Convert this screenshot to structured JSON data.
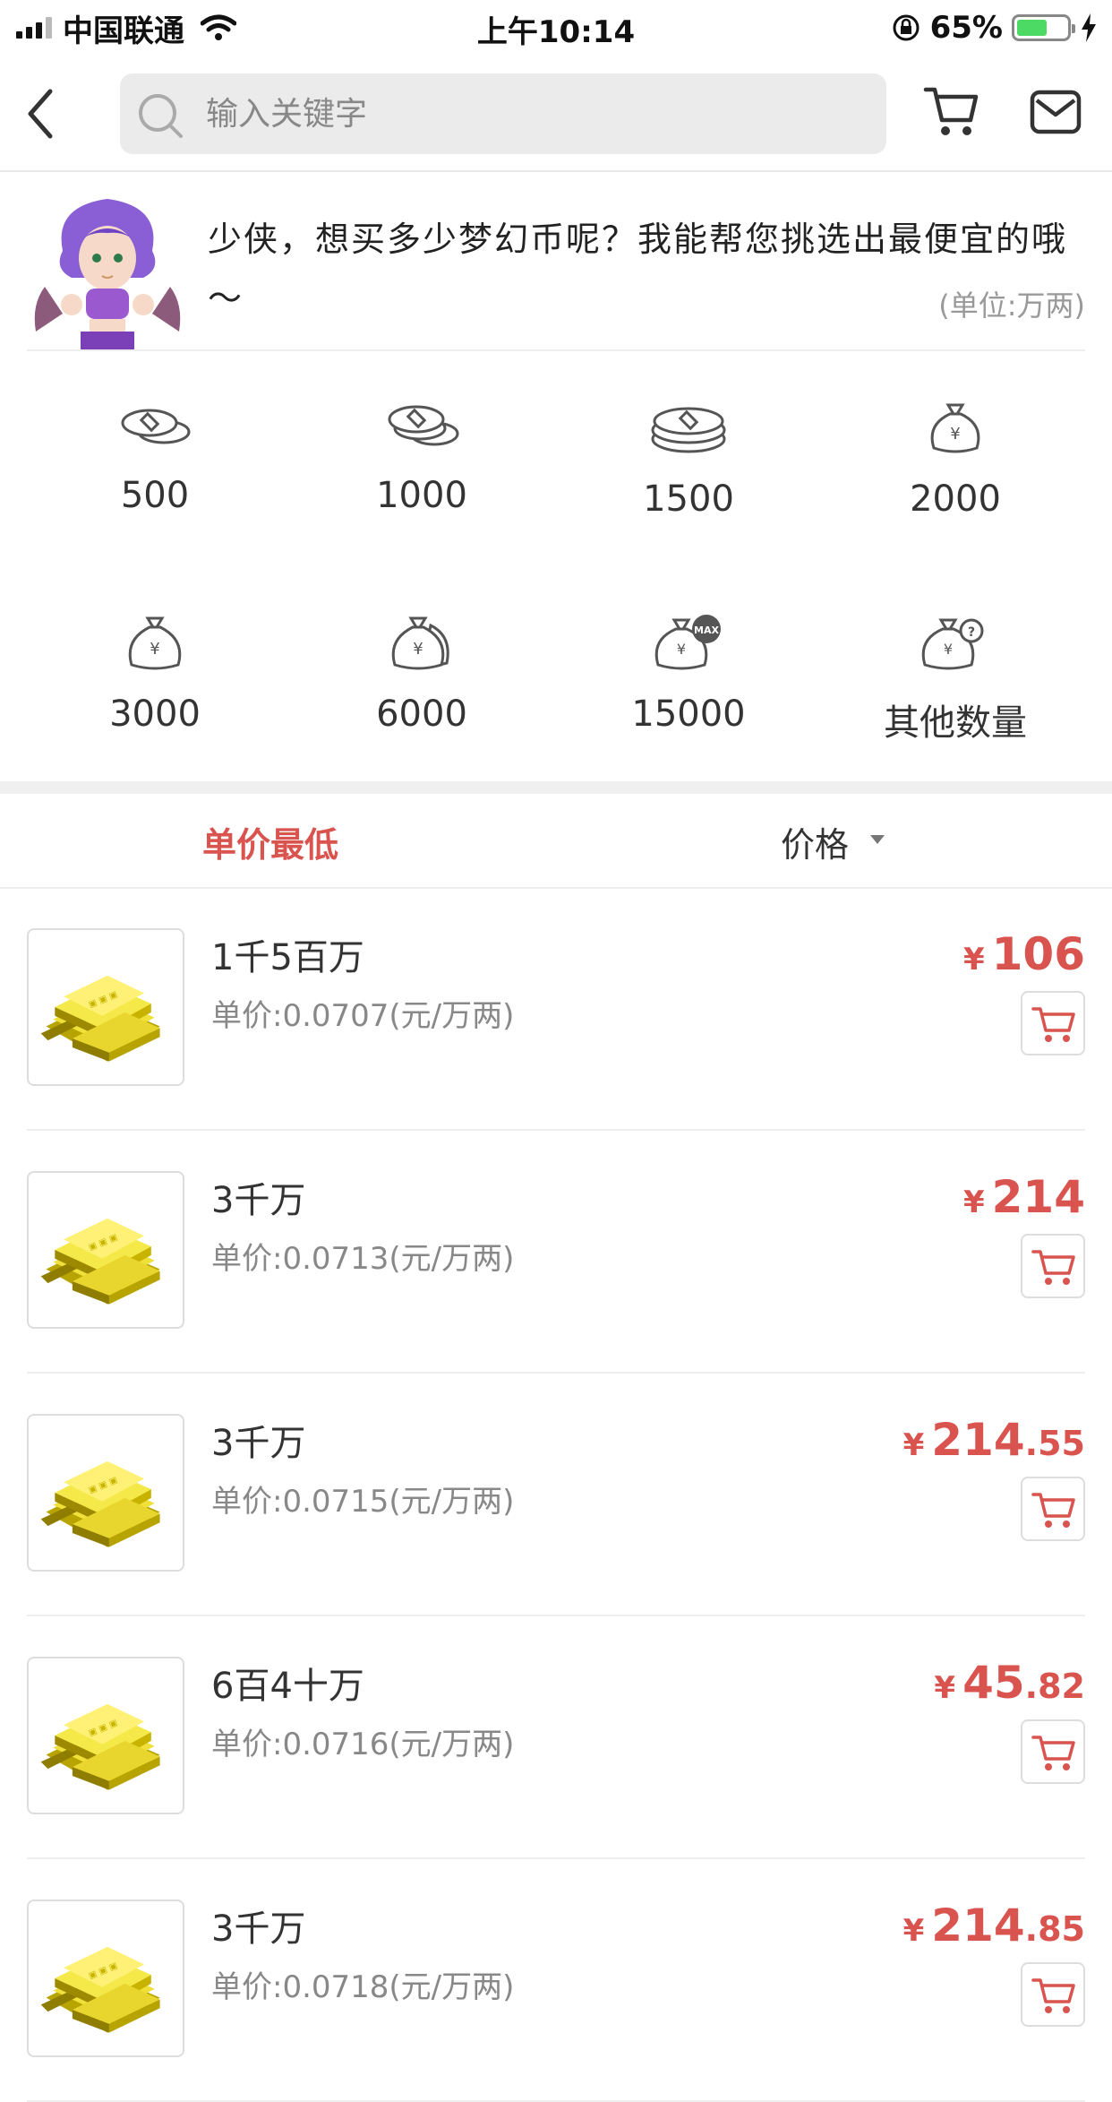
{
  "status_bar": {
    "carrier": "中国联通",
    "time": "上午10:14",
    "battery_percent": "65%",
    "battery_level": 0.65
  },
  "nav": {
    "search_placeholder": "输入关键字"
  },
  "banner": {
    "message": "少侠，想买多少梦幻币呢？我能帮您挑选出最便宜的哦～",
    "unit_note": "(单位:万两)"
  },
  "amounts": [
    {
      "label": "500",
      "icon": "coins-icon"
    },
    {
      "label": "1000",
      "icon": "coins-icon"
    },
    {
      "label": "1500",
      "icon": "coin-stack-icon"
    },
    {
      "label": "2000",
      "icon": "money-bag-icon"
    },
    {
      "label": "3000",
      "icon": "money-bag-icon"
    },
    {
      "label": "6000",
      "icon": "money-bags-icon"
    },
    {
      "label": "15000",
      "icon": "money-bag-max-icon"
    },
    {
      "label": "其他数量",
      "icon": "money-bag-question-icon"
    }
  ],
  "sort": {
    "lowest_label": "单价最低",
    "price_label": "价格"
  },
  "listings": [
    {
      "quantity": "1千5百万",
      "unit_price": "单价:0.0707(元/万两)",
      "currency": "¥",
      "price_int": "106",
      "price_dec": ""
    },
    {
      "quantity": "3千万",
      "unit_price": "单价:0.0713(元/万两)",
      "currency": "¥",
      "price_int": "214",
      "price_dec": ""
    },
    {
      "quantity": "3千万",
      "unit_price": "单价:0.0715(元/万两)",
      "currency": "¥",
      "price_int": "214",
      "price_dec": ".55"
    },
    {
      "quantity": "6百4十万",
      "unit_price": "单价:0.0716(元/万两)",
      "currency": "¥",
      "price_int": "45",
      "price_dec": ".82"
    },
    {
      "quantity": "3千万",
      "unit_price": "单价:0.0718(元/万两)",
      "currency": "¥",
      "price_int": "214",
      "price_dec": ".85"
    }
  ],
  "colors": {
    "accent": "#d9534f",
    "battery": "#4cd964"
  }
}
